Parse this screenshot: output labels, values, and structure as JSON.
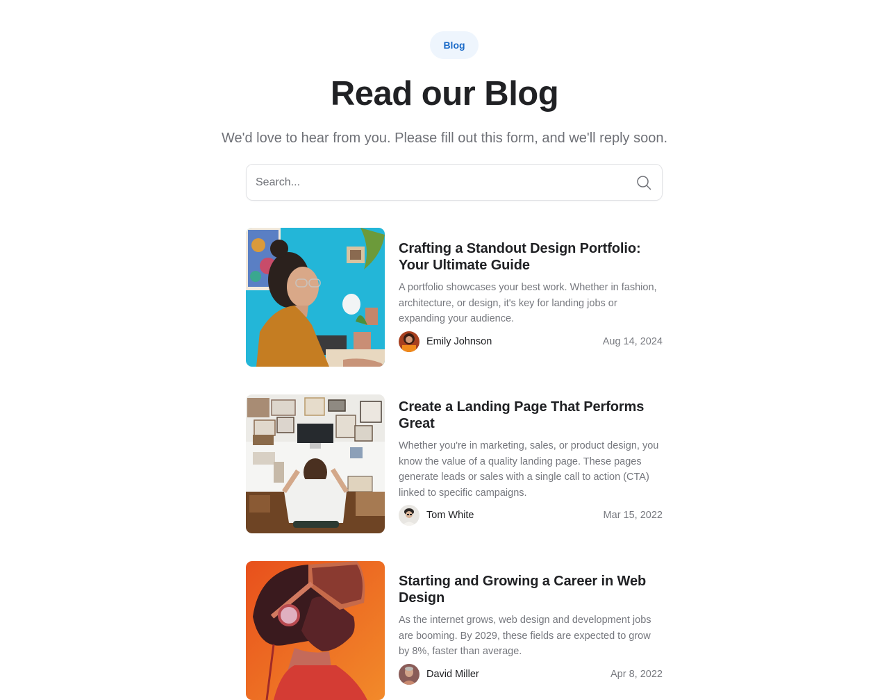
{
  "header": {
    "badge": "Blog",
    "title": "Read our Blog",
    "subtitle": "We'd love to hear from you. Please fill out this form, and we'll reply soon."
  },
  "search": {
    "placeholder": "Search...",
    "value": "",
    "icon": "search-icon"
  },
  "colors": {
    "badge_bg": "#eef5fd",
    "badge_text": "#1c6bc8",
    "heading": "#202124",
    "muted": "#6f7177"
  },
  "posts": [
    {
      "title": "Crafting a Standout Design Portfolio: Your Ultimate Guide",
      "excerpt": "A portfolio showcases your best work. Whether in fashion, architecture, or design, it's key for landing jobs or expanding your audience.",
      "author": "Emily Johnson",
      "date": "Aug 14, 2024",
      "image": "woman-with-glasses-at-desk-photo"
    },
    {
      "title": "Create a Landing Page That Performs Great",
      "excerpt": "Whether you're in marketing, sales, or product design, you know the value of a quality landing page. These pages generate leads or sales with a single call to action (CTA) linked to specific campaigns.",
      "author": "Tom White",
      "date": "Mar 15, 2022",
      "image": "person-working-at-desk-photo"
    },
    {
      "title": "Starting and Growing a Career in Web Design",
      "excerpt": "As the internet grows, web design and development jobs are booming. By 2029, these fields are expected to grow by 8%, faster than average.",
      "author": "David Miller",
      "date": "Apr 8, 2022",
      "image": "person-with-vr-headset-photo"
    }
  ]
}
